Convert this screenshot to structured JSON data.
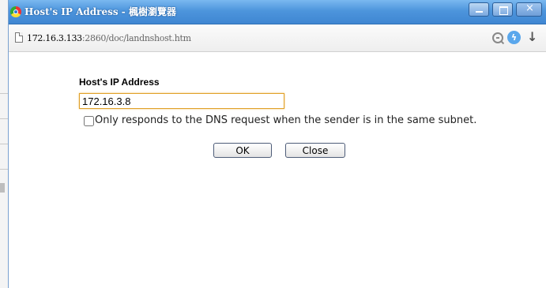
{
  "window": {
    "title": "Host's IP Address - 楓樹瀏覽器"
  },
  "addressbar": {
    "url_host": "172.16.3.133",
    "url_rest": ":2860/doc/landnshost.htm"
  },
  "form": {
    "label": "Host's IP Address",
    "ip_value": "172.16.3.8",
    "checkbox_label": "Only responds to the DNS request when the sender is in the same subnet.",
    "checkbox_checked": false,
    "ok_label": "OK",
    "close_label": "Close"
  },
  "icons": [
    "app-icon",
    "minimize-icon",
    "maximize-icon",
    "close-icon",
    "page-icon",
    "zoom-icon",
    "bolt-icon",
    "download-icon"
  ],
  "colors": {
    "titlebar": "#4d95dc",
    "input_focus_border": "#e0a028"
  }
}
